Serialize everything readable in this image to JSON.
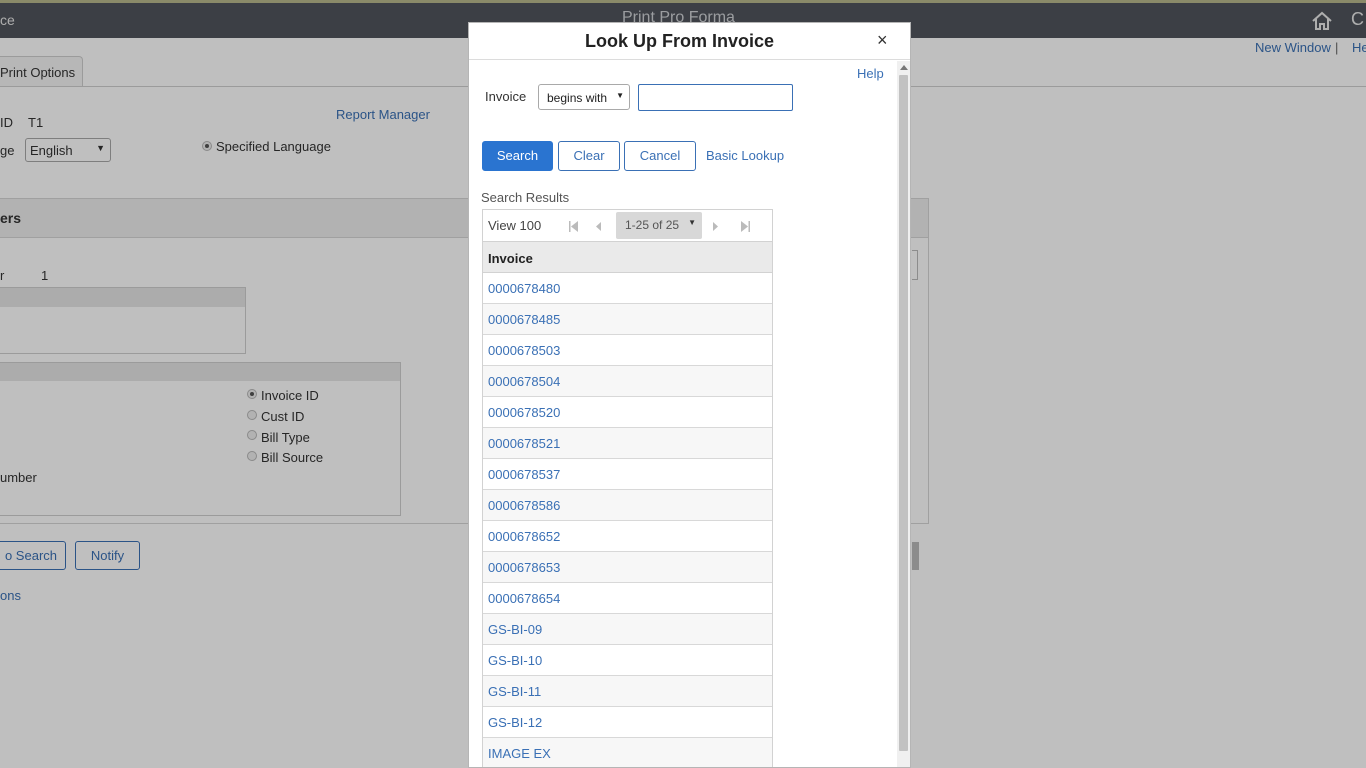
{
  "app": {
    "title_fragment": "ce",
    "page_title": "Print Pro Forma",
    "header_links": {
      "new_window": "New Window",
      "help_fragment": "He",
      "separator": "|"
    }
  },
  "background": {
    "tab_label": "Print Options",
    "report_manager": "Report Manager",
    "id_label": "ID",
    "id_value": "T1",
    "language_label": "ge",
    "language_value": "English",
    "specified_language": "Specified Language",
    "section_title": "ers",
    "number_label": "r",
    "number_value": "1",
    "radio_options": [
      "Invoice ID",
      "Cust ID",
      "Bill Type",
      "Bill Source"
    ],
    "number_fragment": "umber",
    "return_search": "o Search",
    "notify": "Notify",
    "options_fragment": "ons"
  },
  "modal": {
    "title": "Look Up From Invoice",
    "close": "×",
    "help": "Help",
    "field_label": "Invoice",
    "operator": "begins with",
    "input_value": "",
    "buttons": {
      "search": "Search",
      "clear": "Clear",
      "cancel": "Cancel",
      "basic_lookup": "Basic Lookup"
    },
    "results_label": "Search Results",
    "grid": {
      "view_label": "View 100",
      "range": "1-25 of 25",
      "column": "Invoice",
      "rows": [
        "0000678480",
        "0000678485",
        "0000678503",
        "0000678504",
        "0000678520",
        "0000678521",
        "0000678537",
        "0000678586",
        "0000678652",
        "0000678653",
        "0000678654",
        "GS-BI-09",
        "GS-BI-10",
        "GS-BI-11",
        "GS-BI-12",
        "IMAGE EX"
      ]
    }
  }
}
